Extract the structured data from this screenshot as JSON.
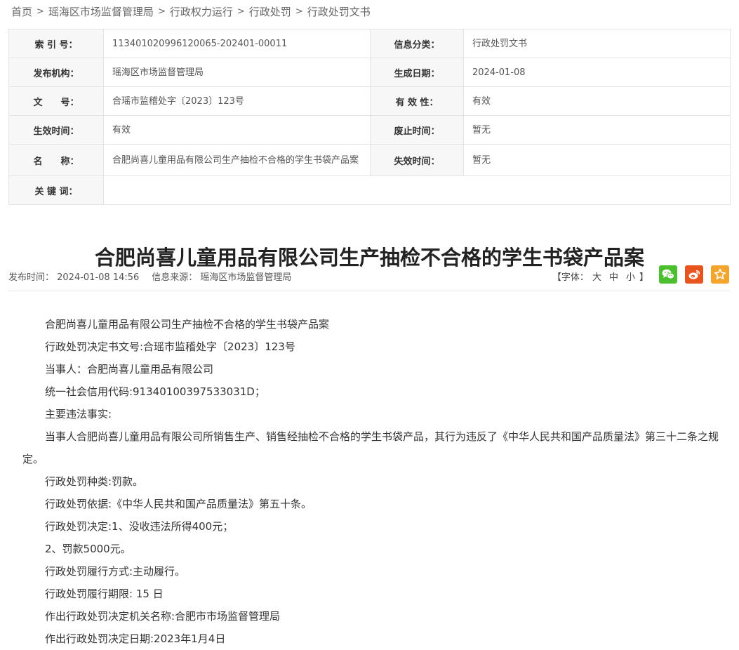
{
  "breadcrumb": [
    "首页",
    "瑶海区市场监督管理局",
    "行政权力运行",
    "行政处罚",
    "行政处罚文书"
  ],
  "meta": {
    "index_no_label": "索 引 号：",
    "index_no": "113401020996120065-202401-00011",
    "category_label": "信息分类：",
    "category": "行政处罚文书",
    "publisher_label": "发布机构：",
    "publisher": "瑶海区市场监督管理局",
    "gen_date_label": "生成日期：",
    "gen_date": "2024-01-08",
    "doc_no_label": "文　　号：",
    "doc_no": "合瑶市监稽处字〔2023〕123号",
    "validity_label": "有 效 性：",
    "validity": "有效",
    "effective_label": "生效时间：",
    "effective": "有效",
    "repeal_label": "废止时间：",
    "repeal": "暂无",
    "name_label": "名　　称：",
    "name": "合肥尚喜儿童用品有限公司生产抽检不合格的学生书袋产品案",
    "expire_label": "失效时间：",
    "expire": "暂无",
    "keywords_label": "关 键 词：",
    "keywords": ""
  },
  "article": {
    "title": "合肥尚喜儿童用品有限公司生产抽检不合格的学生书袋产品案",
    "publish_time": "发布时间： 2024-01-08 14:56",
    "source": "信息来源： 瑶海区市场监督管理局",
    "font_prefix": "【字体：",
    "font_large": "大",
    "font_medium": "中",
    "font_small": "小",
    "font_suffix": "】"
  },
  "share": {
    "icons": [
      "wechat-icon",
      "weibo-icon",
      "favorite-icon"
    ],
    "colors": {
      "wechat": "#4cbf2f",
      "weibo": "#e7541e",
      "favorite": "#f4a52c"
    }
  },
  "content": {
    "paragraphs": [
      "合肥尚喜儿童用品有限公司生产抽检不合格的学生书袋产品案",
      "行政处罚决定书文号:合瑶市监稽处字〔2023〕123号",
      "当事人：合肥尚喜儿童用品有限公司",
      "统一社会信用代码:91340100397533031D；",
      "主要违法事实:",
      "当事人合肥尚喜儿童用品有限公司所销售生产、销售经抽检不合格的学生书袋产品，其行为违反了《中华人民共和国产品质量法》第三十二条之规定。",
      "行政处罚种类:罚款。",
      "行政处罚依据:《中华人民共和国产品质量法》第五十条。",
      "行政处罚决定:1、没收违法所得400元；",
      "2、罚款5000元。",
      "行政处罚履行方式:主动履行。",
      "行政处罚履行期限: 15 日",
      "作出行政处罚决定机关名称:合肥市市场监督管理局",
      "作出行政处罚决定日期:2023年1月4日"
    ]
  }
}
